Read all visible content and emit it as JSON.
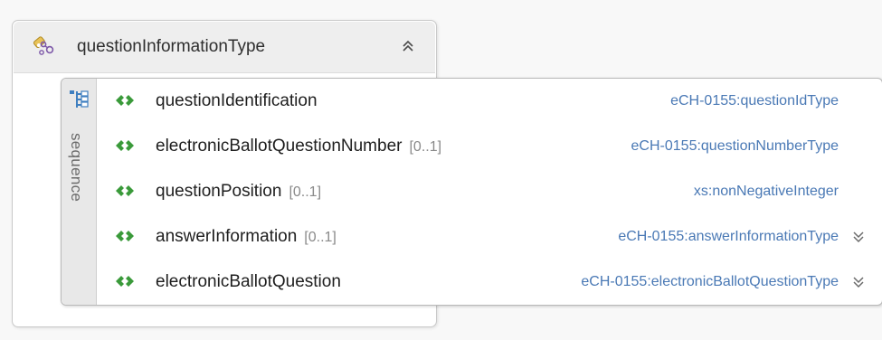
{
  "complex_type": {
    "name": "questionInformationType",
    "icon": "complex-type-icon",
    "collapse_icon": "double-chevron-up-icon"
  },
  "sequence": {
    "label": "sequence",
    "icon": "sequence-icon",
    "elements": [
      {
        "name": "questionIdentification",
        "occurrence": "",
        "type": "eCH-0155:questionIdType",
        "expandable": false
      },
      {
        "name": "electronicBallotQuestionNumber",
        "occurrence": "[0..1]",
        "type": "eCH-0155:questionNumberType",
        "expandable": false
      },
      {
        "name": "questionPosition",
        "occurrence": "[0..1]",
        "type": "xs:nonNegativeInteger",
        "expandable": false
      },
      {
        "name": "answerInformation",
        "occurrence": "[0..1]",
        "type": "eCH-0155:answerInformationType",
        "expandable": true
      },
      {
        "name": "electronicBallotQuestion",
        "occurrence": "",
        "type": "eCH-0155:electronicBallotQuestionType",
        "expandable": true
      }
    ]
  },
  "colors": {
    "type_link": "#4a79b5",
    "element_icon": "#3a9a3a",
    "occurrence": "#8a8a8a"
  }
}
